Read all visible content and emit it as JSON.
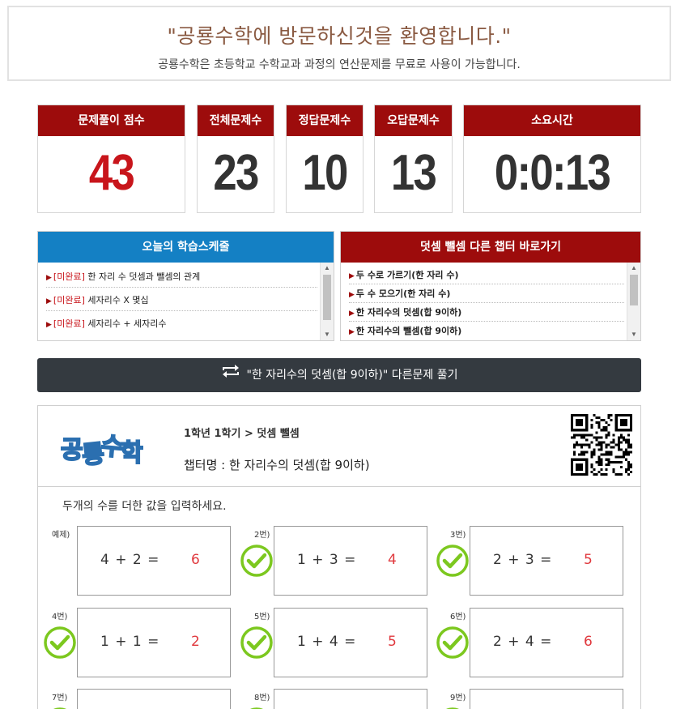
{
  "welcome": {
    "title": "\"공룡수학에 방문하신것을 환영합니다.\"",
    "subtitle": "공룡수학은 초등학교 수학교과 과정의 연산문제를 무료로 사용이 가능합니다."
  },
  "stats": {
    "score": {
      "label": "문제풀이 점수",
      "value": "43"
    },
    "total": {
      "label": "전체문제수",
      "value": "23"
    },
    "correct": {
      "label": "정답문제수",
      "value": "10"
    },
    "wrong": {
      "label": "오답문제수",
      "value": "13"
    },
    "time": {
      "label": "소요시간",
      "value": "0:0:13"
    }
  },
  "schedule": {
    "title": "오늘의 학습스케줄",
    "items": [
      {
        "tag": "[미완료]",
        "text": " 한 자리 수 덧셈과 뺄셈의 관계"
      },
      {
        "tag": "[미완료]",
        "text": " 세자리수 X 몇십"
      },
      {
        "tag": "[미완료]",
        "text": " 세자리수 + 세자리수"
      }
    ]
  },
  "chapters": {
    "title": "덧셈 뺄셈 다른 챕터 바로가기",
    "items": [
      "두 수로 가르기(한 자리 수)",
      "두 수 모으기(한 자리 수)",
      "한 자리수의 덧셈(합 9이하)",
      "한 자리수의 뺄셈(합 9이하)"
    ]
  },
  "other_button": {
    "label": "\"한 자리수의 덧셈(합 9이하)\" 다른문제 풀기"
  },
  "sheet": {
    "logo_text": "공룡수학",
    "breadcrumb": "1학년 1학기 > 덧셈 뺄셈",
    "chapter": "챕터명 : 한 자리수의 덧셈(합 9이하)",
    "instruction": "두개의 수를 더한 값을 입력하세요.",
    "problems": [
      {
        "label": "예제)",
        "equation": "4 + 2 =",
        "answer": "6",
        "checked": false
      },
      {
        "label": "2번)",
        "equation": "1 + 3 =",
        "answer": "4",
        "checked": true
      },
      {
        "label": "3번)",
        "equation": "2 + 3 =",
        "answer": "5",
        "checked": true
      },
      {
        "label": "4번)",
        "equation": "1 + 1 =",
        "answer": "2",
        "checked": true
      },
      {
        "label": "5번)",
        "equation": "1 + 4 =",
        "answer": "5",
        "checked": true
      },
      {
        "label": "6번)",
        "equation": "2 + 4 =",
        "answer": "6",
        "checked": true
      },
      {
        "label": "7번)",
        "equation": "",
        "answer": "",
        "checked": true
      },
      {
        "label": "8번)",
        "equation": "",
        "answer": "",
        "checked": true
      },
      {
        "label": "9번)",
        "equation": "",
        "answer": "",
        "checked": true
      }
    ]
  },
  "colors": {
    "header_red": "#9d0c0c",
    "header_blue": "#1480c4",
    "score_red": "#c8151b",
    "check_green": "#7cc81f",
    "answer_red": "#e0393e"
  }
}
